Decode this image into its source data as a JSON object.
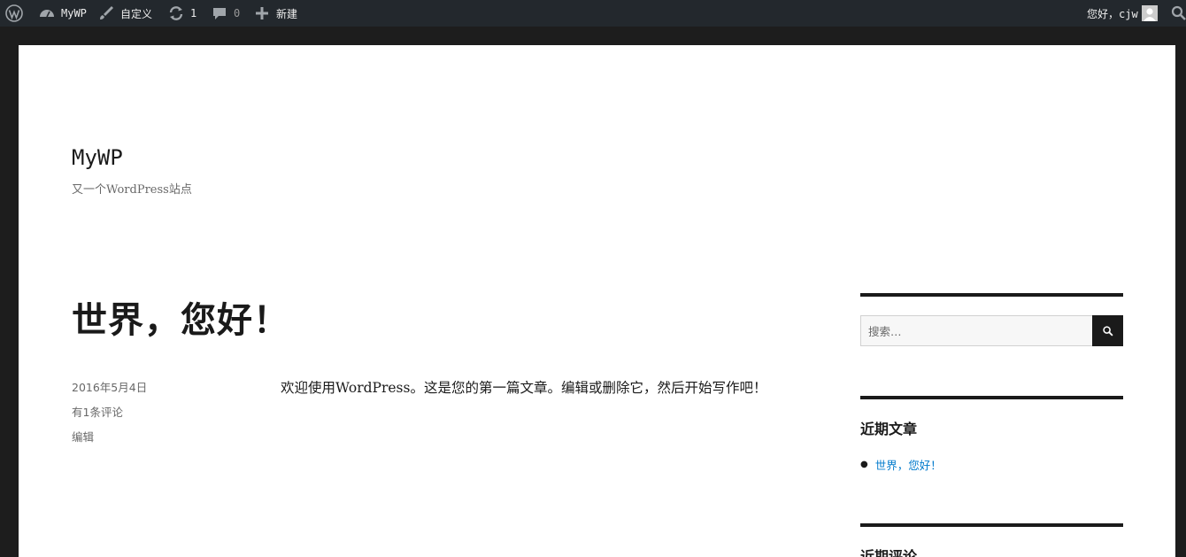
{
  "adminbar": {
    "site_name": "MyWP",
    "customize_label": "自定义",
    "updates_count": "1",
    "comments_count": "0",
    "new_label": "新建",
    "greeting": "您好，cjw"
  },
  "site": {
    "title": "MyWP",
    "description": "又一个WordPress站点"
  },
  "post": {
    "title": "世界，您好！",
    "date": "2016年5月4日",
    "comments": "有1条评论",
    "edit": "编辑",
    "content": "欢迎使用WordPress。这是您的第一篇文章。编辑或删除它，然后开始写作吧！"
  },
  "sidebar": {
    "search_placeholder": "搜索…",
    "recent_title": "近期文章",
    "recent_posts": [
      "世界，您好！"
    ],
    "next_widget_title": "近期评论"
  },
  "colors": {
    "adminbar_bg": "#23282d",
    "page_border": "#1d1d1d",
    "link": "#007acc",
    "text": "#1a1a1a"
  }
}
